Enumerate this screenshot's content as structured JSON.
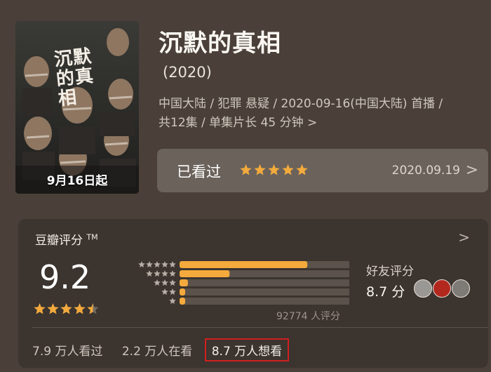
{
  "poster": {
    "title_chars": "沉默的真相",
    "caption": "9月16日起"
  },
  "show": {
    "title": "沉默的真相",
    "year": "(2020)",
    "meta_line1": "中国大陆 / 犯罪 悬疑 / 2020-09-16(中国大陆) 首播 /",
    "meta_line2": "共12集 / 单集片长 45 分钟",
    "meta_chevron": ">"
  },
  "watched": {
    "label": "已看过",
    "stars": 5,
    "date": "2020.09.19",
    "arrow": ">"
  },
  "rating": {
    "heading": "豆瓣评分",
    "trademark": "TM",
    "arrow": ">",
    "score": "9.2",
    "score_stars": 4.5,
    "distribution": [
      0.69,
      0.27,
      0.045,
      0.015,
      0.012
    ],
    "total": "92774 人评分",
    "friend_title": "好友评分",
    "friend_score": "8.7 分"
  },
  "stats": {
    "watched": "7.9 万人看过",
    "watching": "2.2 万人在看",
    "want": "8.7 万人想看"
  },
  "colors": {
    "accent": "#f4aa3c",
    "highlight_border": "#d1201f",
    "panel_bg": "#3b342f",
    "page_bg": "#4a4039"
  }
}
